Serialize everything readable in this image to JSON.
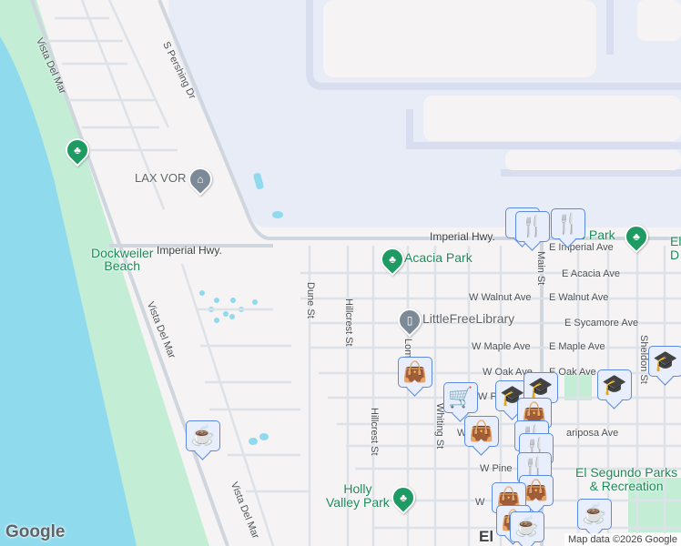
{
  "map": {
    "colors": {
      "water": "#90daee",
      "park": "#c3eed5",
      "land": "#f5f3f3",
      "airport": "#e8ecf7",
      "road": "#cfd6de",
      "poi_green": "#1e9a63",
      "marker_icon": "#0b4164",
      "marker_border": "#5b8be0"
    },
    "roads": {
      "vista_del_mar_1": "Vista Del Mar",
      "vista_del_mar_2": "Vista Del Mar",
      "vista_del_mar_3": "Vista Del Mar",
      "s_pershing": "S Pershing Dr",
      "imperial_hwy_1": "Imperial Hwy.",
      "imperial_hwy_2": "Imperial Hwy.",
      "e_imperial": "E Imperial Ave",
      "e_acacia": "E Acacia Ave",
      "w_walnut": "W Walnut Ave",
      "e_walnut": "E Walnut Ave",
      "e_sycamore": "E Sycamore Ave",
      "w_maple": "W Maple Ave",
      "e_maple": "E Maple Ave",
      "w_oak": "W Oak Ave",
      "e_oak": "E Oak Ave",
      "w_palm": "W P",
      "w_mariposa": "W",
      "mariposa": "ariposa Ave",
      "w_pine": "W Pine",
      "w_other": "W",
      "main_st": "Main St",
      "dune_st": "Dune St",
      "hillcrest_1": "Hillcrest St",
      "hillcrest_2": "Hillcrest St",
      "lomita": "Lomita St",
      "whiting": "Whiting St",
      "sheldon": "Sheldon St"
    },
    "places": {
      "dockweiler": "Dockweiler\nBeach",
      "lax_vor": "LAX VOR",
      "acacia_park": "Acacia Park",
      "library": "LittleFreeLibrary",
      "holly_valley": "Holly\nValley Park",
      "parks_rec": "El Segundo Parks\n& Recreation",
      "rec_park": "s Park",
      "el_partial": "El\nD",
      "el_segundo": "El"
    },
    "branding": {
      "logo": "Google",
      "attribution": "Map data ©2026 Google"
    }
  }
}
